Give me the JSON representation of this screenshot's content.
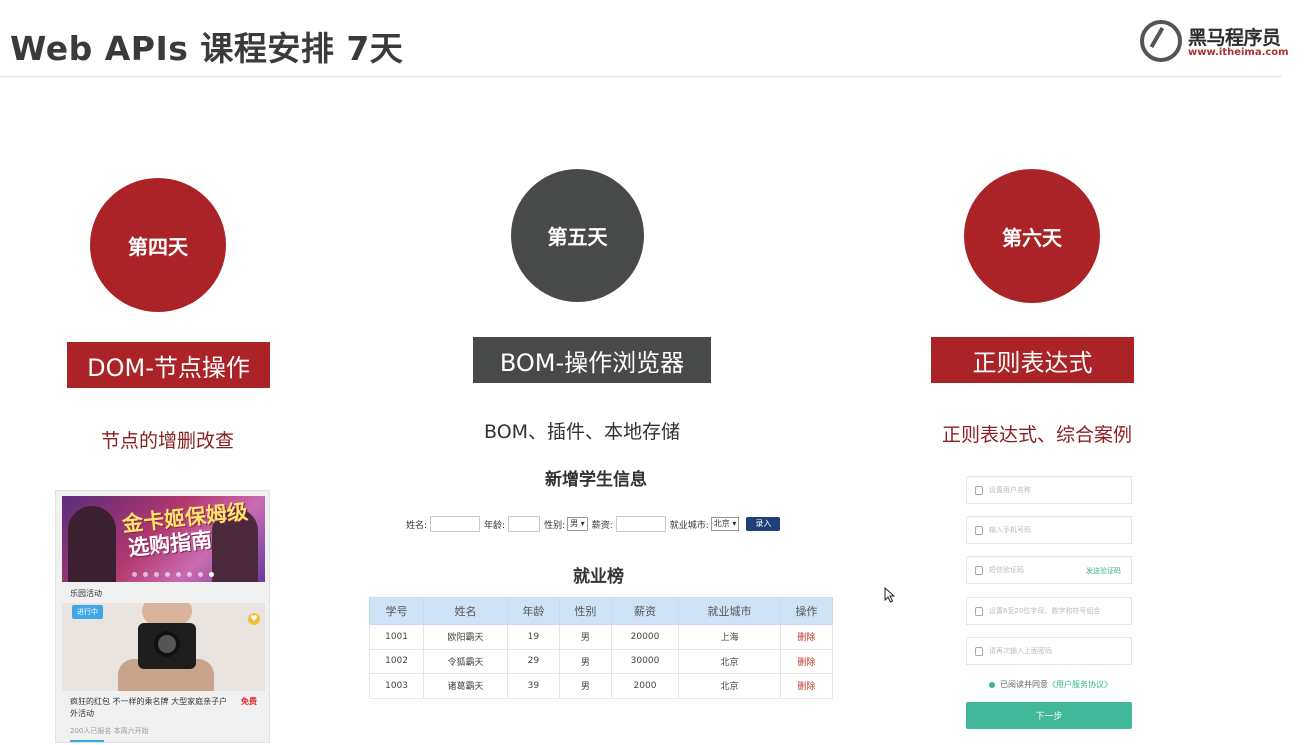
{
  "header": {
    "title": "Web APIs 课程安排 7天",
    "logo_name": "黑马程序员",
    "logo_url": "www.itheima.com"
  },
  "colors": {
    "accent_red": "#ab2326",
    "accent_gray": "#474a49",
    "table_header": "#cfe3f7",
    "primary_button": "#42b89a"
  },
  "days": [
    {
      "circle": "第四天",
      "banner": "DOM-节点操作",
      "subtitle": "节点的增删改查"
    },
    {
      "circle": "第五天",
      "banner": "BOM-操作浏览器",
      "subtitle": "BOM、插件、本地存储"
    },
    {
      "circle": "第六天",
      "banner": "正则表达式",
      "subtitle": "正则表达式、综合案例"
    }
  ],
  "phone_card": {
    "banner_line1": "金卡姬保姆级",
    "banner_line2": "选购指南",
    "section_label": "乐园活动",
    "badge": "进行中",
    "description": "疯狂的红包 不一样的乘名牌 大型家庭亲子户外活动",
    "price_tag": "免费",
    "meta_signups": "200人已报名",
    "meta_time": "本周六开始"
  },
  "student_form": {
    "title": "新增学生信息",
    "name_label": "姓名:",
    "age_label": "年龄:",
    "gender_label": "性别:",
    "gender_value": "男",
    "salary_label": "薪资:",
    "city_label": "就业城市:",
    "city_value": "北京",
    "submit_label": "录入"
  },
  "student_table": {
    "title": "就业榜",
    "headers": [
      "学号",
      "姓名",
      "年龄",
      "性别",
      "薪资",
      "就业城市",
      "操作"
    ],
    "rows": [
      [
        "1001",
        "欧阳霸天",
        "19",
        "男",
        "20000",
        "上海",
        "删除"
      ],
      [
        "1002",
        "令狐霸天",
        "29",
        "男",
        "30000",
        "北京",
        "删除"
      ],
      [
        "1003",
        "诸葛霸天",
        "39",
        "男",
        "2000",
        "北京",
        "删除"
      ]
    ]
  },
  "register_form": {
    "username_placeholder": "设置用户名称",
    "phone_placeholder": "输入手机号码",
    "code_placeholder": "短信验证码",
    "send_code_label": "发送验证码",
    "password_placeholder": "设置6至20位字母、数字和符号组合",
    "confirm_placeholder": "请再次输入上面密码",
    "agree_text": "已阅读并同意",
    "agree_link": "《用户服务协议》",
    "next_label": "下一步"
  }
}
